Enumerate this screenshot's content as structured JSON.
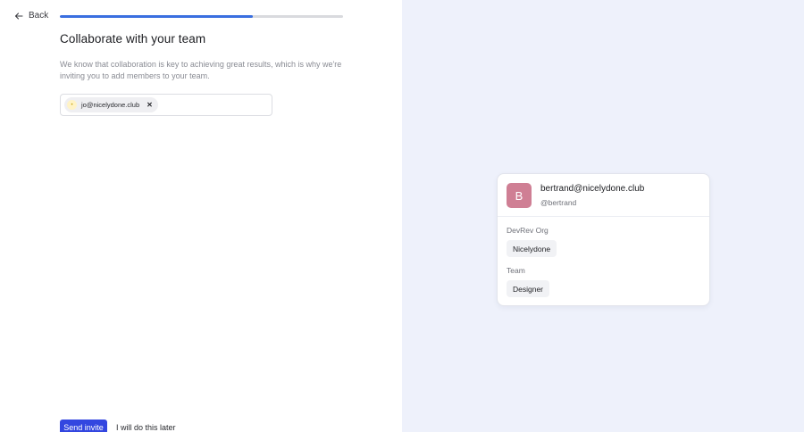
{
  "nav": {
    "back_label": "Back"
  },
  "progress": {
    "percent": 68
  },
  "heading": {
    "title": "Collaborate with your team",
    "description": "We know that collaboration is key to achieving great results, which is why we're inviting you to add members to your team."
  },
  "invite": {
    "chips": [
      {
        "email": "jo@nicelydone.club",
        "avatar_glyph": "•"
      }
    ]
  },
  "actions": {
    "send_label": "Send invite",
    "later_label": "I will do this later"
  },
  "profile_card": {
    "avatar_letter": "B",
    "email": "bertrand@nicelydone.club",
    "handle": "@bertrand",
    "org_label": "DevRev Org",
    "org_value": "Nicelydone",
    "team_label": "Team",
    "team_value": "Designer"
  },
  "colors": {
    "accent": "#3346e0",
    "progress": "#3a6fe0",
    "avatar_bg": "#cf7f94",
    "right_panel_bg": "#eef1fb"
  }
}
